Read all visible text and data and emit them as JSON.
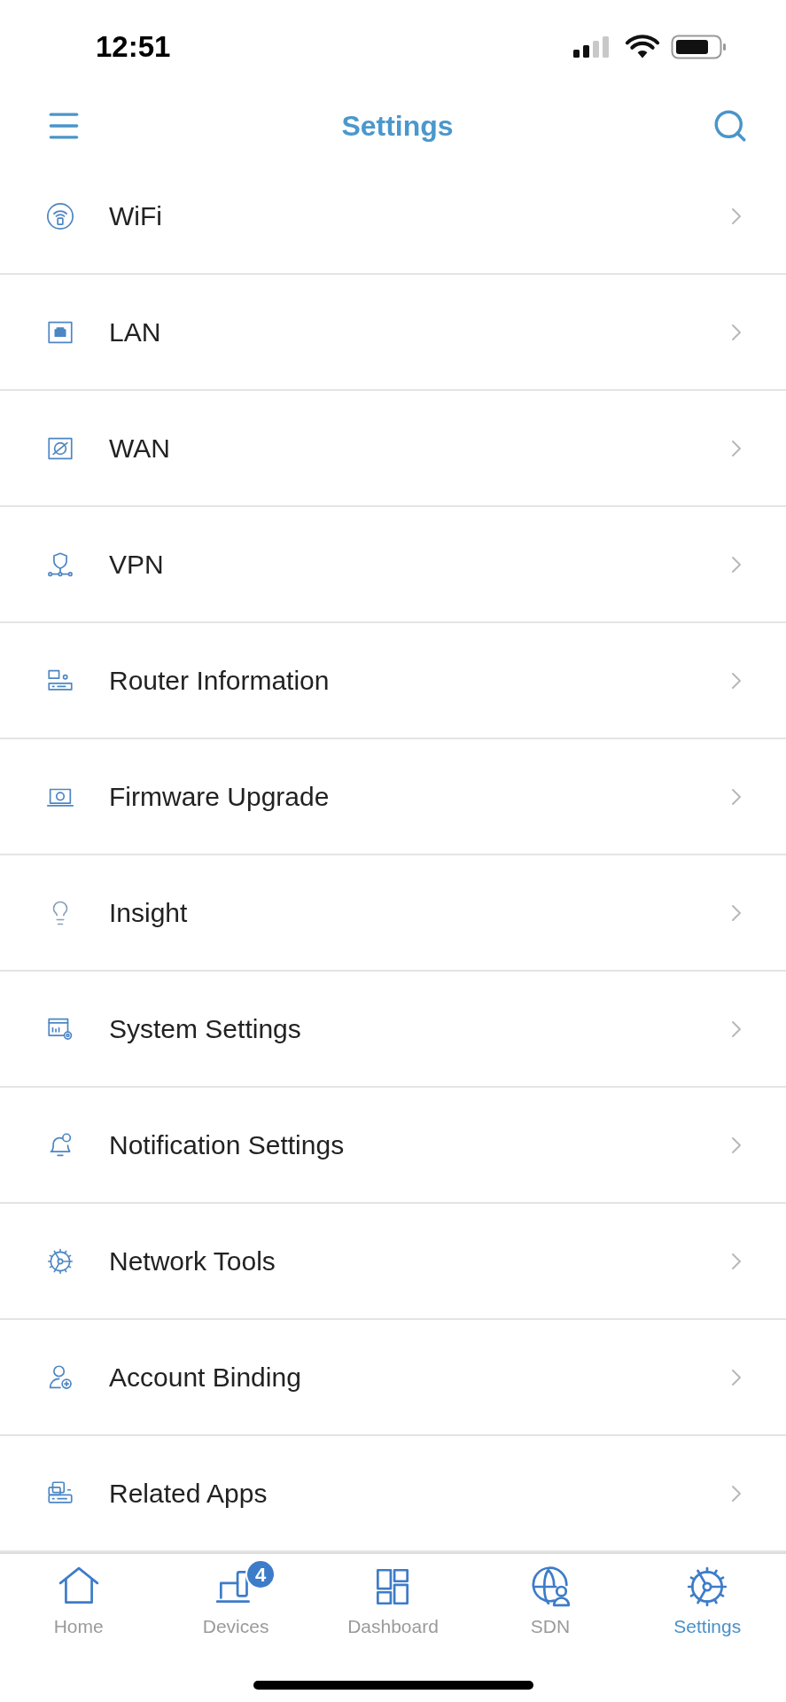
{
  "status_bar": {
    "time": "12:51"
  },
  "header": {
    "title": "Settings"
  },
  "settings_items": [
    {
      "label": "WiFi"
    },
    {
      "label": "LAN"
    },
    {
      "label": "WAN"
    },
    {
      "label": "VPN"
    },
    {
      "label": "Router Information"
    },
    {
      "label": "Firmware Upgrade"
    },
    {
      "label": "Insight"
    },
    {
      "label": "System Settings"
    },
    {
      "label": "Notification Settings"
    },
    {
      "label": "Network Tools"
    },
    {
      "label": "Account Binding"
    },
    {
      "label": "Related Apps"
    }
  ],
  "tab_bar": [
    {
      "label": "Home",
      "selected": false
    },
    {
      "label": "Devices",
      "selected": false,
      "badge": "4"
    },
    {
      "label": "Dashboard",
      "selected": false
    },
    {
      "label": "SDN",
      "selected": false
    },
    {
      "label": "Settings",
      "selected": true
    }
  ]
}
